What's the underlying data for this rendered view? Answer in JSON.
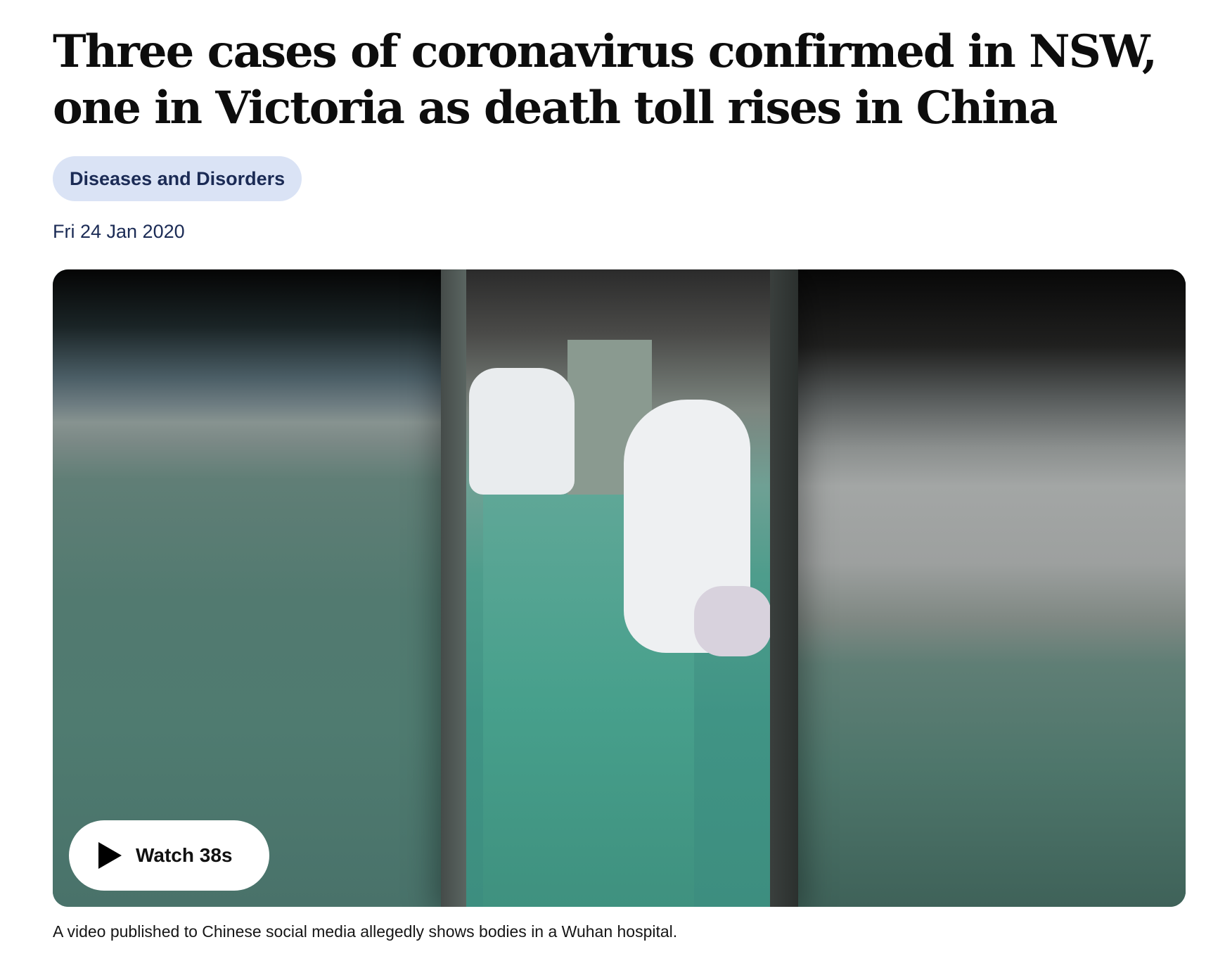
{
  "article": {
    "headline": "Three cases of coronavirus confirmed in NSW, one in Victoria as death toll rises in China",
    "topic_tag": "Diseases and Disorders",
    "date": "Fri 24 Jan 2020"
  },
  "video": {
    "watch_label": "Watch 38s",
    "play_icon": "play-icon",
    "caption": "A video published to Chinese social media allegedly shows bodies in a Wuhan hospital."
  },
  "colors": {
    "tag_background": "#dae3f5",
    "tag_text": "#1b2b55",
    "date_text": "#1b2b55",
    "button_background": "#ffffff"
  }
}
